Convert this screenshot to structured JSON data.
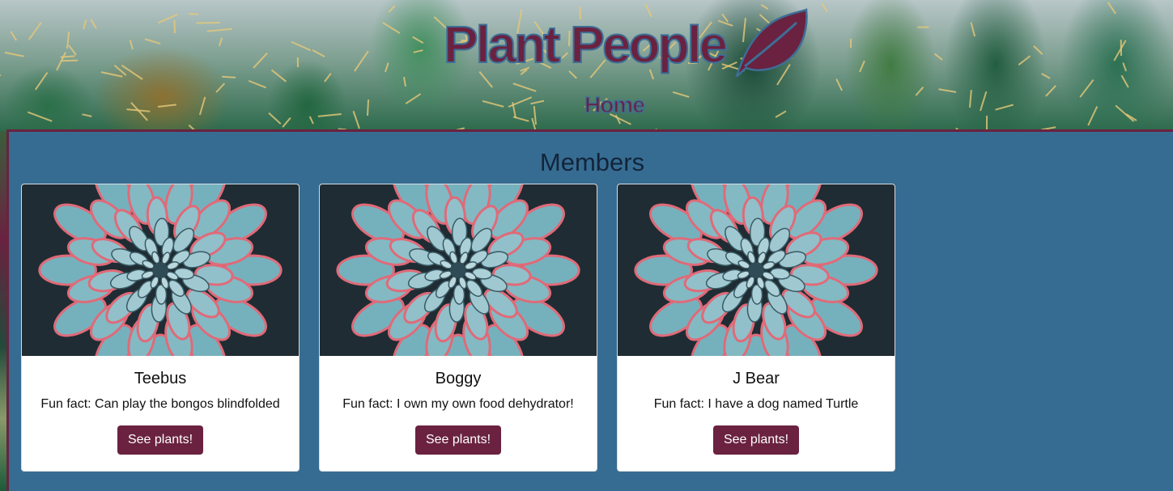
{
  "header": {
    "logo_text": "Plant People",
    "nav_home": "Home"
  },
  "main": {
    "title": "Members",
    "members": [
      {
        "name": "Teebus",
        "fact": "Fun fact: Can play the bongos blindfolded",
        "button": "See plants!"
      },
      {
        "name": "Boggy",
        "fact": "Fun fact: I own my own food dehydrator!",
        "button": "See plants!"
      },
      {
        "name": "J Bear",
        "fact": "Fun fact: I have a dog named Turtle",
        "button": "See plants!"
      }
    ]
  },
  "colors": {
    "brand": "#6a2240",
    "panel": "#376c92",
    "logo_outline": "#3d6e96"
  },
  "icons": {
    "logo": "leaf-icon"
  }
}
